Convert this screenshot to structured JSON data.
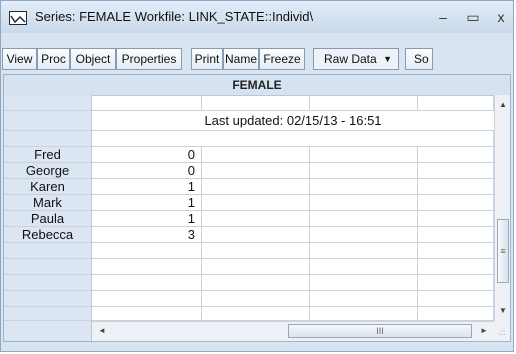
{
  "window": {
    "title": "Series: FEMALE   Workfile: LINK_STATE::Individ\\",
    "minimize_glyph": "–",
    "maximize_glyph": "▭",
    "close_glyph": "x"
  },
  "toolbar": {
    "buttons": [
      "View",
      "Proc",
      "Object",
      "Properties",
      "Print",
      "Name",
      "Freeze"
    ],
    "view_mode": "Raw Data",
    "cut_button": "So"
  },
  "series": {
    "name": "FEMALE",
    "last_updated": "Last updated: 02/15/13 - 16:51",
    "rows": [
      {
        "label": "Fred",
        "value": "0"
      },
      {
        "label": "George",
        "value": "0"
      },
      {
        "label": "Karen",
        "value": "1"
      },
      {
        "label": "Mark",
        "value": "1"
      },
      {
        "label": "Paula",
        "value": "1"
      },
      {
        "label": "Rebecca",
        "value": "3"
      }
    ]
  },
  "scrollbars": {
    "up": "▲",
    "down": "▼",
    "left": "◄",
    "right": "►",
    "v_grip": "≡",
    "h_grip": "III",
    "resize_grip": ".::"
  },
  "icons": {
    "window_icon": "series-graph-icon"
  }
}
